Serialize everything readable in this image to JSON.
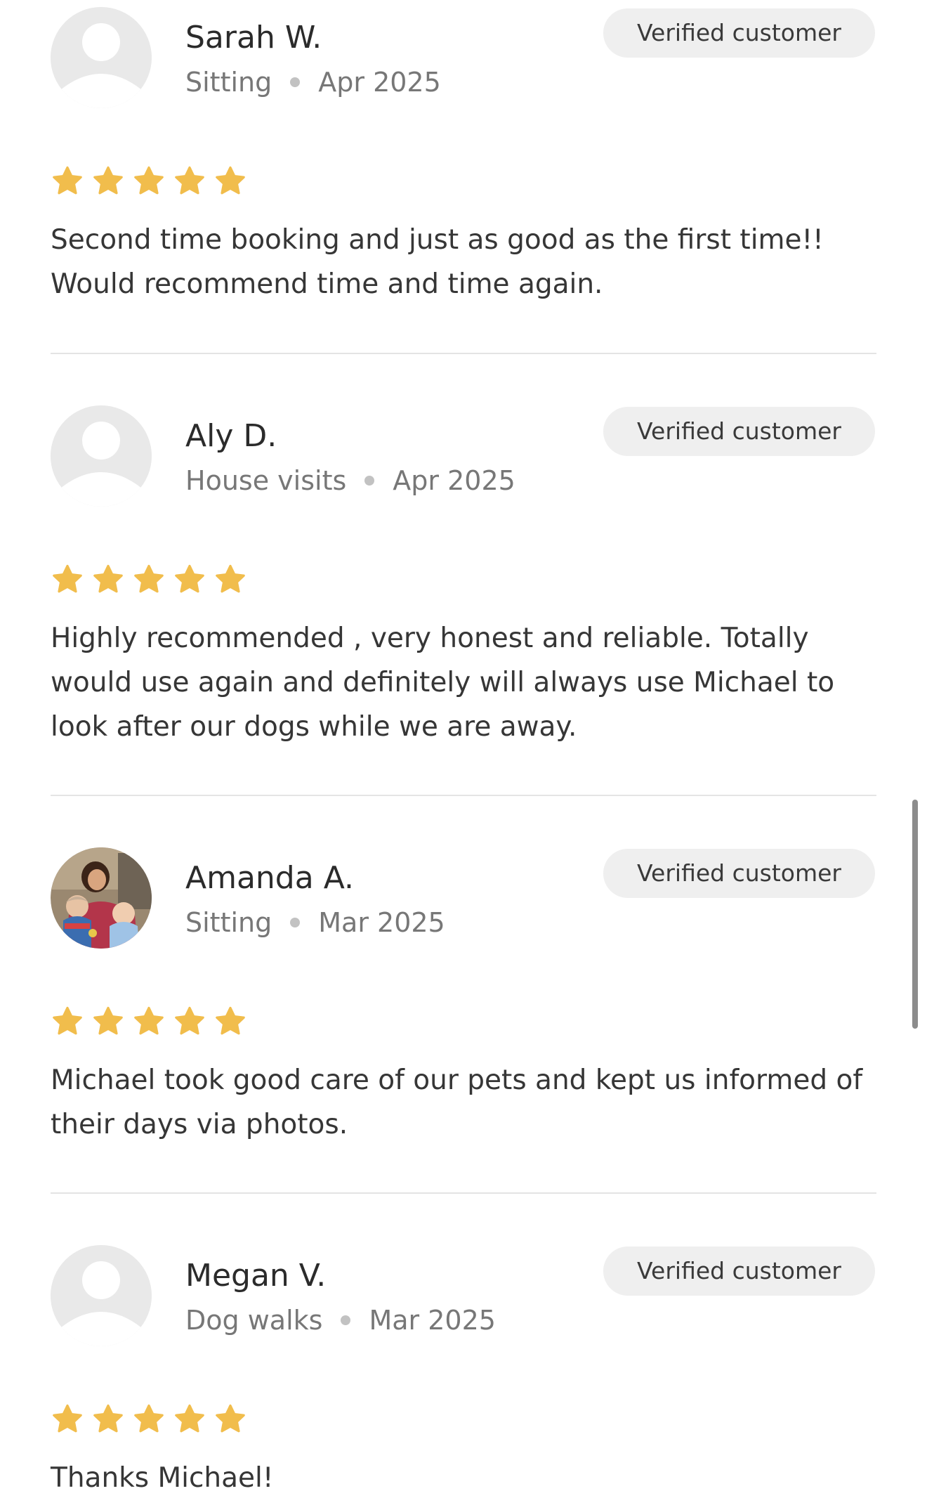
{
  "colors": {
    "star": "#f1bd4c",
    "badge_bg": "#efefef",
    "avatar_bg": "#e9e9e9",
    "avatar_figure": "#ffffff"
  },
  "reviews": [
    {
      "name": "Sarah W.",
      "service": "Sitting",
      "date": "Apr 2025",
      "badge": "Verified customer",
      "rating": 5,
      "text": "Second time booking and just as good as the first time!! Would recommend time and time again.",
      "avatar": "default-avatar-icon"
    },
    {
      "name": "Aly D.",
      "service": "House visits",
      "date": "Apr 2025",
      "badge": "Verified customer",
      "rating": 5,
      "text": "Highly recommended , very honest and reliable. Totally would use again and definitely will always use Michael to look after our dogs while we are away.",
      "avatar": "default-avatar-icon"
    },
    {
      "name": "Amanda A.",
      "service": "Sitting",
      "date": "Mar 2025",
      "badge": "Verified customer",
      "rating": 5,
      "text": "Michael took good care of our pets and kept us informed of their days via photos.",
      "avatar": "user-photo"
    },
    {
      "name": "Megan V.",
      "service": "Dog walks",
      "date": "Mar 2025",
      "badge": "Verified customer",
      "rating": 5,
      "text": "Thanks Michael!",
      "avatar": "default-avatar-icon"
    }
  ]
}
